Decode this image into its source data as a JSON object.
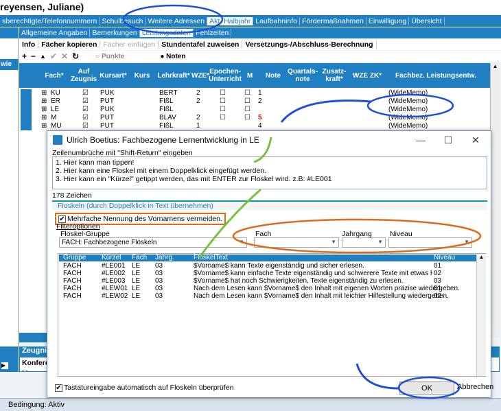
{
  "window_title": "reyensen, Juliane)",
  "tabs1": [
    "sberechtigte/Telefonnummern",
    "Schulbesuch",
    "Weitere Adressen",
    "Akt. Halbjahr",
    "Laufbahninfo",
    "Fördermaßnahmen",
    "Einwilligung",
    "Übersicht"
  ],
  "tabs1_active": 3,
  "tabs2": [
    "Allgemeine Angaben",
    "Bemerkungen",
    "Leistungsdaten",
    "Fehlzeiten"
  ],
  "tabs2_active": 2,
  "left_hdr": "wie",
  "toolbar": {
    "info": "Info",
    "copy": "Fächer kopieren",
    "paste": "Fächer einfügen",
    "assign": "Stundentafel zuweisen",
    "calc": "Versetzungs-/Abschluss-Berechnung"
  },
  "mode": {
    "punkte": "Punkte",
    "noten": "Noten"
  },
  "grid_headers": {
    "fach": "Fach*",
    "auf": "Auf Zeugnis",
    "kursart": "Kursart*",
    "kurs": "Kurs",
    "lehrkraft": "Lehrkraft*",
    "wze": "WZE*",
    "epoch": "Epochen-Unterricht",
    "m": "M",
    "note": "Note",
    "quartal": "Quartals-note",
    "zusatz": "Zusatz-kraft*",
    "wzezk": "WZE ZK*",
    "fachbez": "Fachbez. Leistungsentw."
  },
  "rows": [
    {
      "fach": "KU",
      "kursart": "PUK",
      "lehrkraft": "BERT",
      "wze": "2",
      "note": "1",
      "memo": "(WideMemo)"
    },
    {
      "fach": "ER",
      "kursart": "PUT",
      "lehrkraft": "FIßL",
      "wze": "2",
      "note": "2",
      "memo": "(WideMemo)"
    },
    {
      "fach": "LE",
      "kursart": "PUK",
      "lehrkraft": "FIßL",
      "wze": "",
      "note": "",
      "memo": "(WideMemo)"
    },
    {
      "fach": "M",
      "kursart": "PUT",
      "lehrkraft": "BLAV",
      "wze": "2",
      "note": "5",
      "memo": "(WideMemo)"
    },
    {
      "fach": "MU",
      "kursart": "PUT",
      "lehrkraft": "FIßL",
      "wze": "1",
      "note": "4",
      "memo": "(WideMemo)"
    }
  ],
  "zeugnis": {
    "title": "Zeugnis/A",
    "konf": "Konferenz",
    "dash": "- -"
  },
  "status": "Bedingung: Aktiv",
  "dialog": {
    "title": "Ulrich Boetius: Fachbezogene Lernentwicklung in LE",
    "hint": "Zeilenumbrüche mit \"Shift-Return\" eingeben",
    "lines": [
      "1. Hier kann man tippen!",
      "2. Hier kann eine Floskel mit einem Doppelklick eingefügt werden.",
      "3. Hier kann ein \"Kürzel\" getippt werden, das mit ENTER zur Floskel wird. z.B: #LE001"
    ],
    "count": "178 Zeichen",
    "floskeln": "Floskeln (durch Doppelklick in Text übernehmen)",
    "avoid": "Mehrfache Nennung des Vornamens vermeiden.",
    "filter": "Filteroptionen",
    "group_label": "Floskel-Gruppe",
    "group_value": "FACH: Fachbezogene Floskeln",
    "fach_label": "Fach",
    "jahrgang_label": "Jahrgang",
    "niveau_label": "Niveau",
    "cols": {
      "gruppe": "Gruppe",
      "kuerzel": "Kürzel",
      "fach": "Fach",
      "jahrg": "Jahrg.",
      "text": "FloskelText",
      "niveau": "Niveau"
    },
    "floskel_rows": [
      {
        "g": "FACH",
        "k": "#LE001",
        "f": "LE",
        "j": "03",
        "t": "$Vorname$ kann Texte eigenständig und sicher erlesen.",
        "n": "01"
      },
      {
        "g": "FACH",
        "k": "#LE002",
        "f": "LE",
        "j": "03",
        "t": "$Vorname$ kann einfache Texte eigenständig und schwerere Texte mit etwas Hilfe erlesen",
        "n": "02"
      },
      {
        "g": "FACH",
        "k": "#LE003",
        "f": "LE",
        "j": "03",
        "t": "$Vorname$ hat noch Schwierigkeiten, Texte eigenständig zu erlesen.",
        "n": "03"
      },
      {
        "g": "FACH",
        "k": "#LEW01",
        "f": "LE",
        "j": "03",
        "t": "Nach dem Lesen kann $Vorname$ den Inhalt mit eigenen Worten präzise wiedergeben.",
        "n": "01"
      },
      {
        "g": "FACH",
        "k": "#LEW02",
        "f": "LE",
        "j": "03",
        "t": "Nach dem Lesen kann $Vorname$ den Inhalt mit leichter Hilfestellung wiedergeben.",
        "n": "02"
      }
    ],
    "auto": "Tastatureingabe automatisch auf Floskeln überprüfen",
    "ok": "OK",
    "cancel": "Abbrechen"
  }
}
